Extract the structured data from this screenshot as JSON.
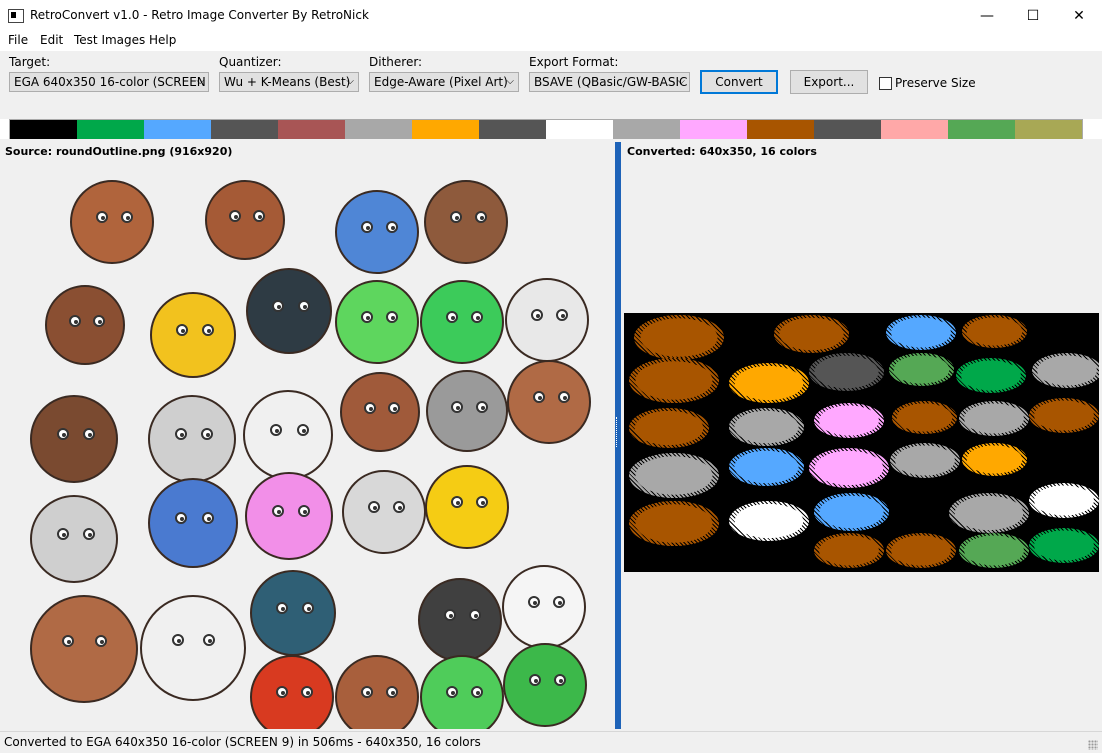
{
  "window": {
    "title": "RetroConvert v1.0 - Retro Image Converter By RetroNick",
    "controls": {
      "minimize": "—",
      "maximize": "☐",
      "close": "✕"
    }
  },
  "menu": [
    "File",
    "Edit",
    "Test Images",
    "Help"
  ],
  "toolbar": {
    "target_label": "Target:",
    "target_value": "EGA 640x350 16-color (SCREEN 9)",
    "quantizer_label": "Quantizer:",
    "quantizer_value": "Wu + K-Means (Best)",
    "ditherer_label": "Ditherer:",
    "ditherer_value": "Edge-Aware (Pixel Art)",
    "export_label": "Export Format:",
    "export_value": "BSAVE (QBasic/GW-BASIC",
    "convert_label": "Convert",
    "export_button_label": "Export...",
    "preserve_label": "Preserve Size",
    "preserve_checked": false
  },
  "palette": [
    "#000000",
    "#00a84a",
    "#55a8ff",
    "#555555",
    "#a85555",
    "#a8a8a8",
    "#ffa800",
    "#555555",
    "#ffffff",
    "#a8a8a8",
    "#ffa8ff",
    "#a85500",
    "#555555",
    "#ffa8a8",
    "#55a855",
    "#a8a855"
  ],
  "source": {
    "label": "Source: roundOutline.png (916x920)"
  },
  "converted": {
    "label": "Converted: 640x350, 16 colors"
  },
  "status": "Converted to EGA 640x350 16-color (SCREEN 9) in 506ms - 640x350, 16 colors",
  "icons": {
    "app": "app-icon",
    "dropdown": "chevron-down-icon"
  }
}
